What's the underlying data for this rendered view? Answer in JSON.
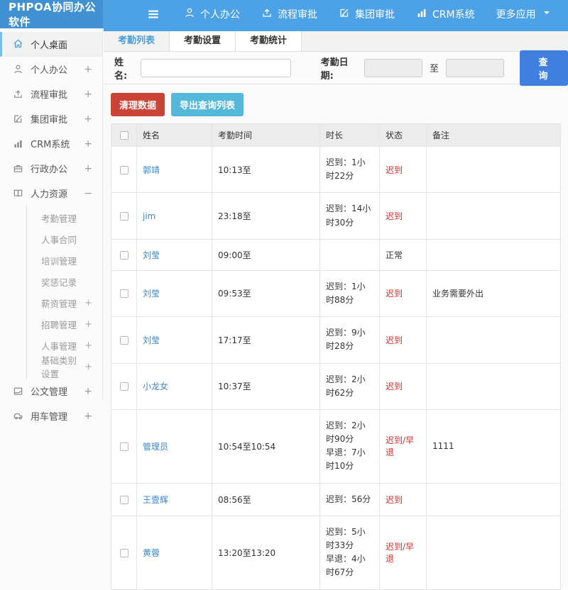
{
  "header": {
    "logo": "PHPOA协同办公软件",
    "nav": [
      {
        "label": "个人办公",
        "icon": "user-icon"
      },
      {
        "label": "流程审批",
        "icon": "flow-icon"
      },
      {
        "label": "集团审批",
        "icon": "edit-icon"
      },
      {
        "label": "CRM系统",
        "icon": "chart-icon"
      },
      {
        "label": "更多应用",
        "icon": "caret-down-icon",
        "caret": true
      }
    ]
  },
  "sidebar": {
    "items": [
      {
        "label": "个人桌面",
        "icon": "home-icon",
        "active": true
      },
      {
        "label": "个人办公",
        "icon": "user-icon",
        "suffix": "+"
      },
      {
        "label": "流程审批",
        "icon": "flow-icon",
        "suffix": "+"
      },
      {
        "label": "集团审批",
        "icon": "edit-icon",
        "suffix": "+"
      },
      {
        "label": "CRM系统",
        "icon": "chart-icon",
        "suffix": "+"
      },
      {
        "label": "行政办公",
        "icon": "briefcase-icon",
        "suffix": "+"
      },
      {
        "label": "人力资源",
        "icon": "book-icon",
        "suffix": "−",
        "expanded": true,
        "children": [
          {
            "label": "考勤管理"
          },
          {
            "label": "人事合同"
          },
          {
            "label": "培训管理"
          },
          {
            "label": "奖惩记录"
          },
          {
            "label": "薪资管理",
            "suffix": "+"
          },
          {
            "label": "招聘管理",
            "suffix": "+"
          },
          {
            "label": "人事管理",
            "suffix": "+"
          },
          {
            "label": "基础类别设置",
            "suffix": "+"
          }
        ]
      },
      {
        "label": "公文管理",
        "icon": "doc-icon",
        "suffix": "+"
      },
      {
        "label": "用车管理",
        "icon": "car-icon",
        "suffix": "+"
      }
    ]
  },
  "tabs": [
    {
      "label": "考勤列表",
      "active": true
    },
    {
      "label": "考勤设置"
    },
    {
      "label": "考勤统计"
    }
  ],
  "search": {
    "name_label": "姓名:",
    "name_value": "",
    "date_label": "考勤日期:",
    "date_from_value": "",
    "to_label": "至",
    "date_to_value": "",
    "submit_label": "查 询"
  },
  "actions": {
    "clean_label": "清理数据",
    "export_label": "导出查询列表"
  },
  "table": {
    "columns": [
      "姓名",
      "考勤时间",
      "时长",
      "状态",
      "备注"
    ],
    "rows": [
      {
        "name": "郭靖",
        "time": "10:13至",
        "duration": [
          "迟到：1小时22分"
        ],
        "status": "迟到",
        "status_red": true,
        "note": ""
      },
      {
        "name": "jim",
        "time": "23:18至",
        "duration": [
          "迟到：14小时30分"
        ],
        "status": "迟到",
        "status_red": true,
        "note": ""
      },
      {
        "name": "刘莹",
        "time": "09:00至",
        "duration": [],
        "status": "正常",
        "status_red": false,
        "note": ""
      },
      {
        "name": "刘莹",
        "time": "09:53至",
        "duration": [
          "迟到：1小时88分"
        ],
        "status": "迟到",
        "status_red": true,
        "note": "业务需要外出"
      },
      {
        "name": "刘莹",
        "time": "17:17至",
        "duration": [
          "迟到：9小时28分"
        ],
        "status": "迟到",
        "status_red": true,
        "note": ""
      },
      {
        "name": "小龙女",
        "time": "10:37至",
        "duration": [
          "迟到：2小时62分"
        ],
        "status": "迟到",
        "status_red": true,
        "note": ""
      },
      {
        "name": "管理员",
        "time": "10:54至10:54",
        "duration": [
          "迟到：2小时90分",
          "早退：7小时10分"
        ],
        "status": "迟到/早退",
        "status_red": true,
        "note": "1111"
      },
      {
        "name": "王壹辉",
        "time": "08:56至",
        "duration": [
          "迟到：56分"
        ],
        "status": "迟到",
        "status_red": true,
        "note": ""
      },
      {
        "name": "黄蓉",
        "time": "13:20至13:20",
        "duration": [
          "迟到：5小时33分",
          "早退：4小时67分"
        ],
        "status": "迟到/早退",
        "status_red": true,
        "note": ""
      }
    ]
  },
  "colors": {
    "header_blue": "#4ca2e4",
    "logo_blue": "#4191d2",
    "active_tab_blue": "#4a9ed8",
    "query_button_blue": "#3e7fdf",
    "clean_button_red": "#cb4336",
    "export_button_blue": "#54b8da",
    "name_link_blue": "#3a87c8",
    "status_late_red": "#c9302c"
  }
}
